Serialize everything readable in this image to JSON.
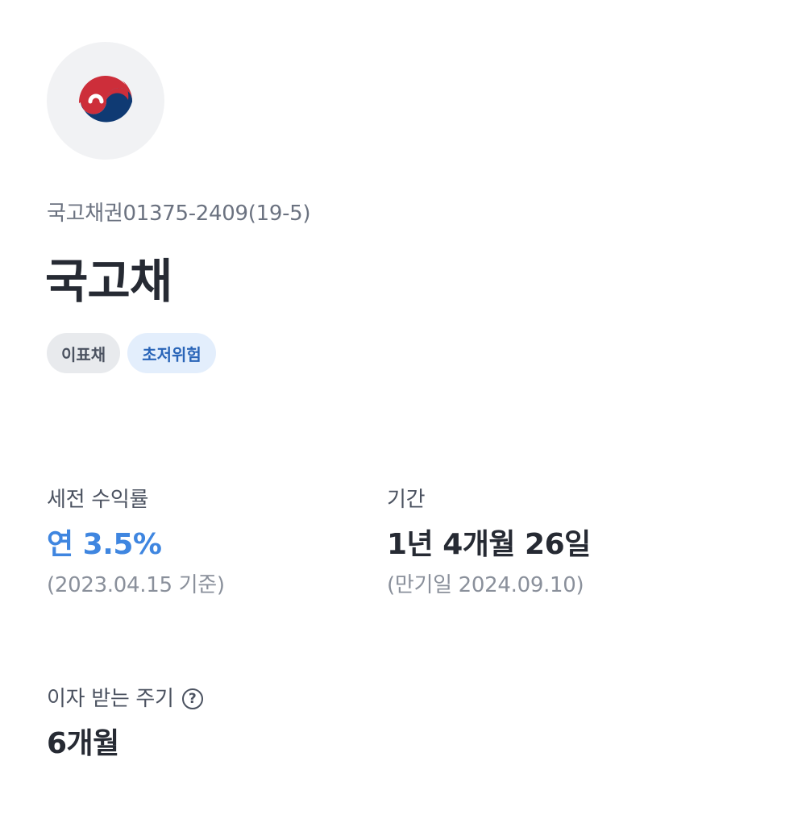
{
  "header": {
    "logo_icon": "korea-government-emblem-icon",
    "bond_code": "국고채권01375-2409(19-5)",
    "bond_name": "국고채"
  },
  "tags": [
    {
      "label": "이표채",
      "style": "gray"
    },
    {
      "label": "초저위험",
      "style": "blue"
    }
  ],
  "yield": {
    "label": "세전 수익률",
    "value": "연 3.5%",
    "note": "(2023.04.15 기준)"
  },
  "term": {
    "label": "기간",
    "value": "1년 4개월 26일",
    "note": "(만기일 2024.09.10)"
  },
  "interest_cycle": {
    "label": "이자 받는 주기",
    "help_icon": "question-circle-icon",
    "help_glyph": "?",
    "value": "6개월"
  },
  "colors": {
    "accent_blue": "#3f86e0",
    "emblem_red": "#cd2e3a",
    "emblem_blue": "#0f3a73"
  }
}
